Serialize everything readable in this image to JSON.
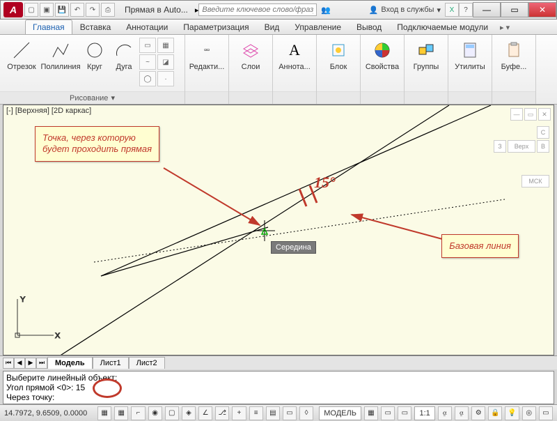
{
  "title": "Прямая в Auto...",
  "search_placeholder": "Введите ключевое слово/фразу",
  "signin_label": "Вход в службы",
  "tabs": {
    "home": "Главная",
    "insert": "Вставка",
    "annotate": "Аннотации",
    "param": "Параметризация",
    "view": "Вид",
    "manage": "Управление",
    "output": "Вывод",
    "plugins": "Подключаемые модули"
  },
  "ribbon": {
    "draw_panel": "Рисование",
    "line": "Отрезок",
    "polyline": "Полилиния",
    "circle": "Круг",
    "arc": "Дуга",
    "edit": "Редакти...",
    "layers": "Слои",
    "annot": "Аннота...",
    "block": "Блок",
    "props": "Свойства",
    "groups": "Группы",
    "util": "Утилиты",
    "clip": "Буфе..."
  },
  "viewport_label": "[-] [Верхняя] [2D каркас]",
  "viewcube": {
    "top": "С",
    "left": "З",
    "right": "В",
    "front": "Верх",
    "wcs": "МСК"
  },
  "callout1_line1": "Точка, через которую",
  "callout1_line2": "будет проходить прямая",
  "callout2": "Базовая линия",
  "angle_text": "15°",
  "tooltip": "Середина",
  "layout": {
    "model": "Модель",
    "sheet1": "Лист1",
    "sheet2": "Лист2"
  },
  "cmd": {
    "l1": "Выберите линейный объект:",
    "l2": "Угол прямой <0>: 15",
    "l3": "Через точку:"
  },
  "status": {
    "coords": "14.7972, 9.6509, 0.0000",
    "mode": "МОДЕЛЬ",
    "scale": "1:1"
  }
}
